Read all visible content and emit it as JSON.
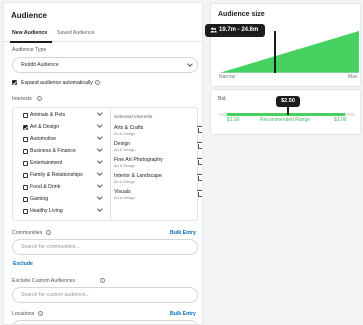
{
  "header": {
    "title": "Audience"
  },
  "tabs": [
    {
      "label": "New Audience",
      "active": true
    },
    {
      "label": "Saved Audience",
      "active": false
    }
  ],
  "audience_type": {
    "label": "Audience Type",
    "value": "Reddit Audience"
  },
  "expand": {
    "label": "Expand audience automatically",
    "checked": true
  },
  "interests": {
    "label": "Interests",
    "items": [
      {
        "label": "Animals & Pets",
        "checked": false
      },
      {
        "label": "Art & Design",
        "checked": true
      },
      {
        "label": "Automotive",
        "checked": false
      },
      {
        "label": "Business & Finance",
        "checked": false
      },
      {
        "label": "Entertainment",
        "checked": false
      },
      {
        "label": "Family & Relationships",
        "checked": false
      },
      {
        "label": "Food & Drink",
        "checked": false
      },
      {
        "label": "Gaming",
        "checked": false
      },
      {
        "label": "Healthy Living",
        "checked": false
      }
    ],
    "selected_header": "Selected Interests",
    "selected": [
      {
        "name": "Arts & Crafts",
        "category": "Art & Design"
      },
      {
        "name": "Design",
        "category": "Art & Design"
      },
      {
        "name": "Fine Art Photography",
        "category": "Art & Design"
      },
      {
        "name": "Interior & Landscape",
        "category": "Art & Design"
      },
      {
        "name": "Visuals",
        "category": "Art & Design"
      }
    ]
  },
  "communities": {
    "label": "Communities",
    "bulk": "Bulk Entry",
    "placeholder": "Search for communities...",
    "exclude": "Exclude"
  },
  "exclude_custom": {
    "label": "Exclude Custom Audiences",
    "placeholder": "Search for custom audience..."
  },
  "locations": {
    "label": "Locations",
    "bulk": "Bulk Entry"
  },
  "audience_size": {
    "title": "Audience size",
    "range": "19.7m - 24.6m",
    "min_label": "Narrow",
    "max_label": "Max"
  },
  "bid": {
    "label": "Bid",
    "value": "$2.50",
    "min": "$1.00",
    "recommended": "Recommended Range",
    "max": "$3.00"
  },
  "colors": {
    "accent_green": "#46d160",
    "dark": "#1c1c1c",
    "link_blue": "#0a6cbd"
  }
}
